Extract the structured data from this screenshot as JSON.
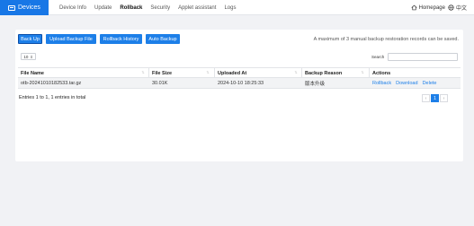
{
  "brand": {
    "title": "Devices"
  },
  "nav": {
    "items": [
      {
        "label": "Device Info"
      },
      {
        "label": "Update"
      },
      {
        "label": "Rollback"
      },
      {
        "label": "Security"
      },
      {
        "label": "Applet assistant"
      },
      {
        "label": "Logs"
      }
    ],
    "active": "Rollback"
  },
  "header": {
    "homepage": "Homepage",
    "language": "中文"
  },
  "toolbar": {
    "backup_up": "Back Up",
    "upload": "Upload Backup File",
    "history": "Rollback History",
    "auto": "Auto Backup",
    "note": "A maximum of 3 manual backup restoration records can be saved."
  },
  "table_controls": {
    "page_size": "10",
    "search_label": "Search",
    "search_value": ""
  },
  "table": {
    "columns": [
      "File Name",
      "File Size",
      "Uploaded At",
      "Backup Reason",
      "Actions"
    ],
    "rows": [
      {
        "file_name": "otb-20241010182533.tar.gz",
        "size": "30.01K",
        "uploaded": "2024-10-10 18:25:33",
        "reason": "版本升级",
        "actions": [
          "Rollback",
          "Download",
          "Delete"
        ]
      }
    ]
  },
  "footer": {
    "entries": "Entries 1 to 1, 1 entries in total"
  },
  "pagination": {
    "prev": "‹",
    "current": "1",
    "next": "›"
  },
  "colors": {
    "accent": "#1d7fe8",
    "brand": "#1877e6",
    "background": "#f1f2f5"
  }
}
